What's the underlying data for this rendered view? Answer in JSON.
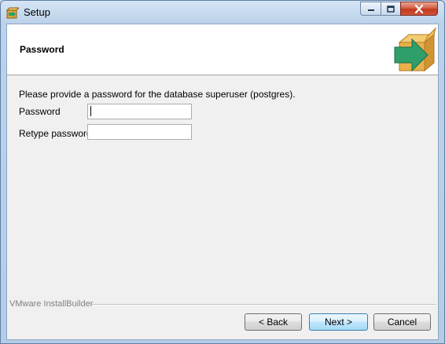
{
  "window": {
    "title": "Setup",
    "controls": {
      "minimize": "minimize",
      "maximize": "maximize",
      "close": "close"
    }
  },
  "header": {
    "title": "Password"
  },
  "body": {
    "intro": "Please provide a password for the database superuser (postgres).",
    "password_label": "Password",
    "password_value": "",
    "retype_label": "Retype password",
    "retype_value": ""
  },
  "footer": {
    "brand": "VMware InstallBuilder",
    "back_label": "< Back",
    "next_label": "Next >",
    "cancel_label": "Cancel"
  },
  "colors": {
    "accent_arrow": "#2e9e6a",
    "box": "#e8b04a"
  }
}
